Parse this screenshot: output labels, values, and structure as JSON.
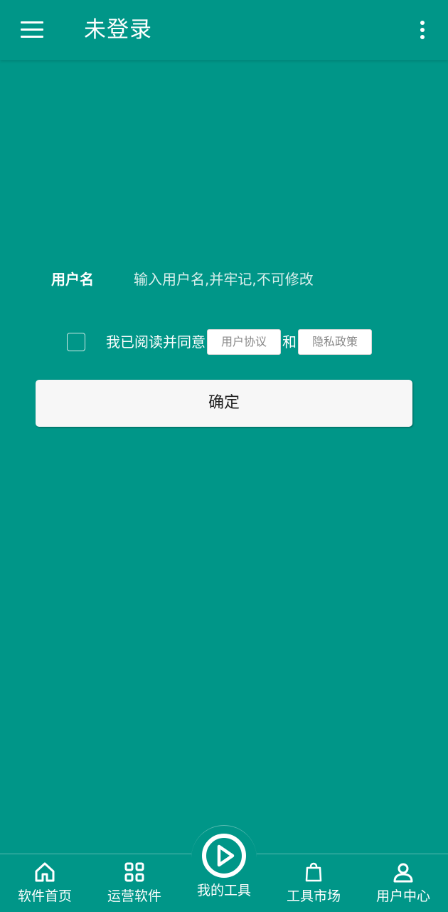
{
  "app_bar": {
    "title": "未登录",
    "menu_icon": "hamburger-menu-icon",
    "more_icon": "more-vertical-icon"
  },
  "form": {
    "username_label": "用户名",
    "username_placeholder": "输入用户名,并牢记,不可修改",
    "username_value": "",
    "agree_checked": false,
    "agree_text": "我已阅读并同意",
    "terms_label": "用户协议",
    "and_text": "和",
    "privacy_label": "隐私政策",
    "confirm_label": "确定"
  },
  "bottom_nav": {
    "items": [
      {
        "label": "软件首页",
        "icon": "home-icon"
      },
      {
        "label": "运营软件",
        "icon": "grid-icon"
      },
      {
        "label": "我的工具",
        "icon": "play-circle-icon"
      },
      {
        "label": "工具市场",
        "icon": "shopping-bag-icon"
      },
      {
        "label": "用户中心",
        "icon": "user-icon"
      }
    ]
  },
  "colors": {
    "primary": "#009688",
    "button_bg": "#f7f7f7",
    "text_on_primary": "#ffffff"
  }
}
